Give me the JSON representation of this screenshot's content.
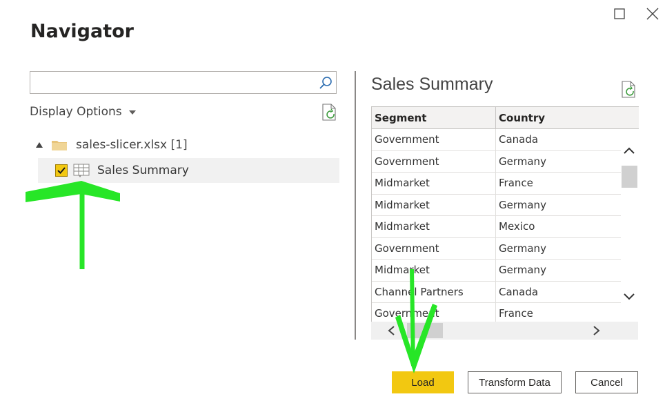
{
  "dialog": {
    "title": "Navigator"
  },
  "search": {
    "value": "",
    "placeholder": ""
  },
  "display_options": {
    "label": "Display Options"
  },
  "tree": {
    "folder": {
      "label": "sales-slicer.xlsx [1]"
    },
    "items": [
      {
        "label": "Sales Summary",
        "checked": true
      }
    ]
  },
  "preview": {
    "title": "Sales Summary",
    "columns": [
      "Segment",
      "Country"
    ],
    "rows": [
      [
        "Government",
        "Canada"
      ],
      [
        "Government",
        "Germany"
      ],
      [
        "Midmarket",
        "France"
      ],
      [
        "Midmarket",
        "Germany"
      ],
      [
        "Midmarket",
        "Mexico"
      ],
      [
        "Government",
        "Germany"
      ],
      [
        "Midmarket",
        "Germany"
      ],
      [
        "Channel Partners",
        "Canada"
      ],
      [
        "Government",
        "France"
      ]
    ]
  },
  "buttons": {
    "load": "Load",
    "transform": "Transform Data",
    "cancel": "Cancel"
  },
  "colors": {
    "accent": "#f2c811",
    "annotation": "#27e627"
  },
  "icons": {
    "maximize": "maximize-icon",
    "close": "close-icon",
    "search": "search-icon",
    "refresh": "refresh-icon",
    "folder": "folder-icon",
    "table": "table-icon"
  }
}
